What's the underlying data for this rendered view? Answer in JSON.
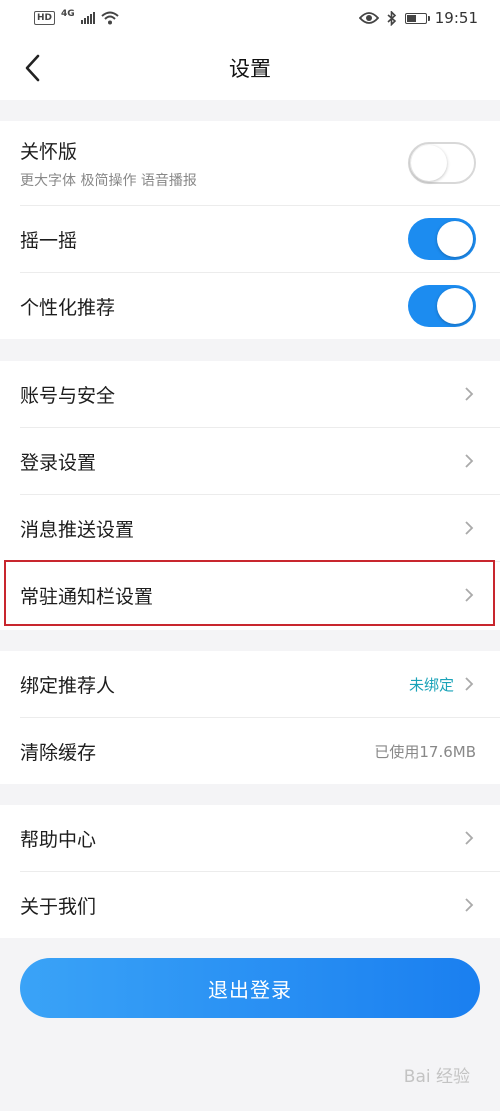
{
  "status_bar": {
    "time": "19:51",
    "hd": "HD",
    "network": "4G"
  },
  "nav": {
    "title": "设置"
  },
  "group1": {
    "care_mode": {
      "label": "关怀版",
      "sub": "更大字体 极简操作 语音播报",
      "enabled": false
    },
    "shake": {
      "label": "摇一摇",
      "enabled": true
    },
    "personalized": {
      "label": "个性化推荐",
      "enabled": true
    }
  },
  "group2": {
    "account_security": {
      "label": "账号与安全"
    },
    "login_settings": {
      "label": "登录设置"
    },
    "push_settings": {
      "label": "消息推送设置"
    },
    "notification_bar": {
      "label": "常驻通知栏设置"
    }
  },
  "group3": {
    "bind_referrer": {
      "label": "绑定推荐人",
      "value": "未绑定"
    },
    "clear_cache": {
      "label": "清除缓存",
      "value": "已使用17.6MB"
    }
  },
  "group4": {
    "help_center": {
      "label": "帮助中心"
    },
    "about_us": {
      "label": "关于我们"
    }
  },
  "logout": {
    "label": "退出登录"
  },
  "watermark": "Bai 经验",
  "colors": {
    "accent": "#1c8cf0",
    "link": "#1aa3b8",
    "highlight": "#c8262e"
  }
}
